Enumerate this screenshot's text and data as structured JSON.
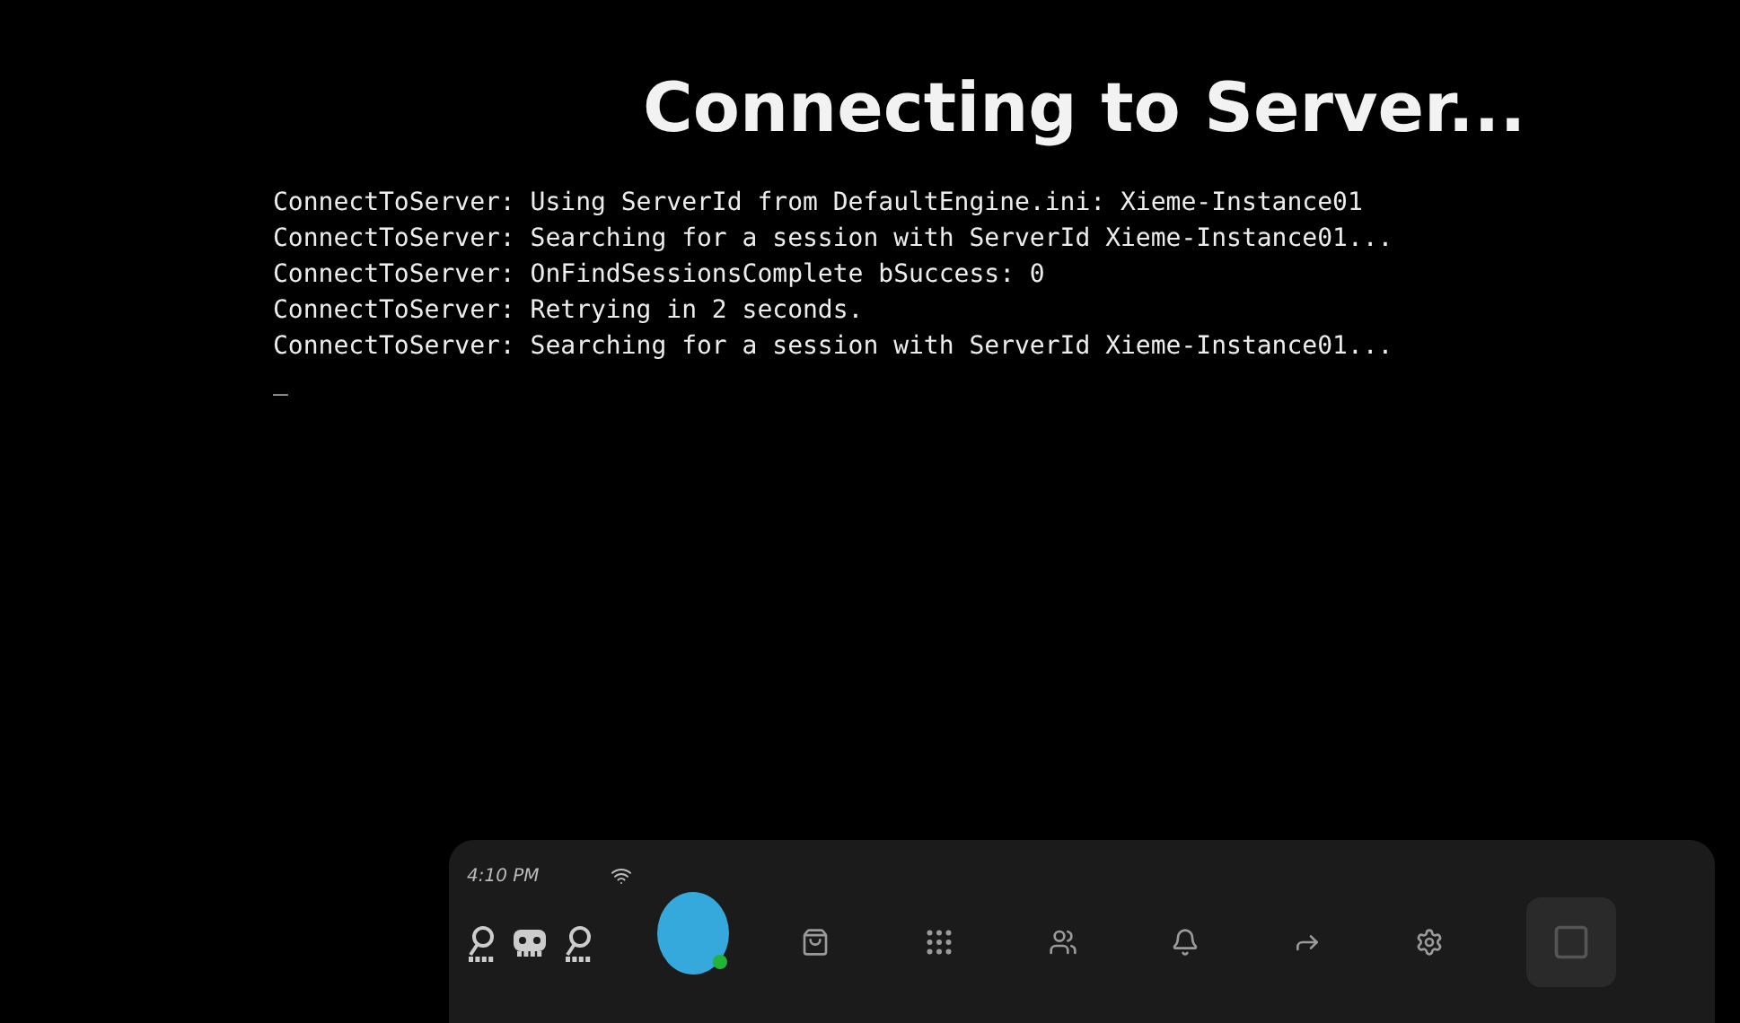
{
  "title": "Connecting to Server...",
  "log": [
    "ConnectToServer: Using ServerId from DefaultEngine.ini: Xieme-Instance01",
    "ConnectToServer: Searching for a session with ServerId Xieme-Instance01...",
    "ConnectToServer: OnFindSessionsComplete bSuccess: 0",
    "ConnectToServer: Retrying in 2 seconds.",
    "ConnectToServer: Searching for a session with ServerId Xieme-Instance01..."
  ],
  "cursor": "_",
  "menu_bar": {
    "time": "4:10 PM"
  }
}
